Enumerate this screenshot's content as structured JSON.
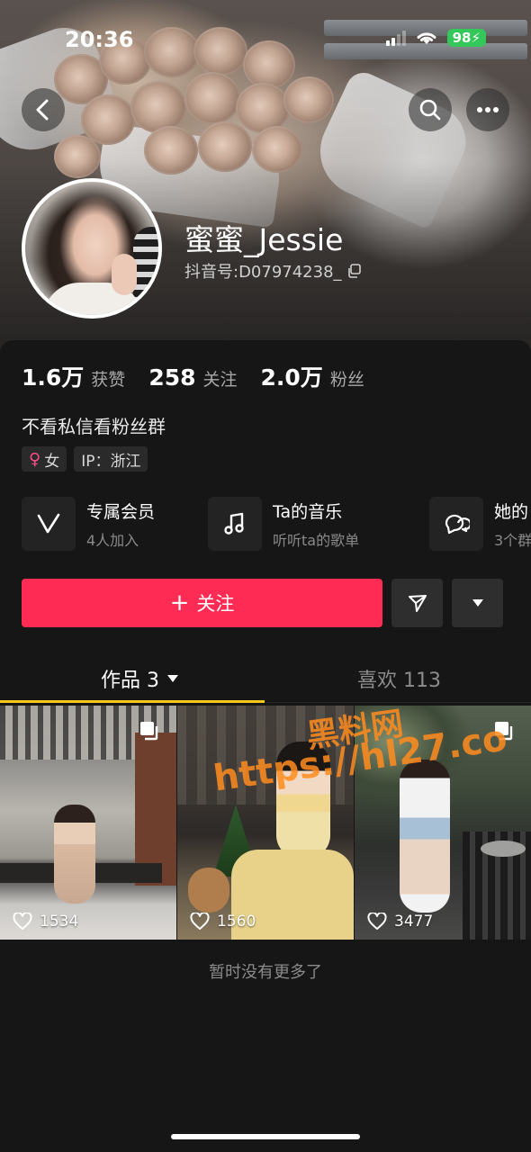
{
  "status_bar": {
    "time": "20:36",
    "battery": "98"
  },
  "profile": {
    "name": "蜜蜜_Jessie",
    "douyin_id": "抖音号:D07974238_",
    "stats": [
      {
        "value": "1.6万",
        "label": "获赞"
      },
      {
        "value": "258",
        "label": "关注"
      },
      {
        "value": "2.0万",
        "label": "粉丝"
      }
    ],
    "bio": "不看私信看粉丝群",
    "tags": {
      "gender": "女",
      "ip": "IP：浙江"
    }
  },
  "features": [
    {
      "title": "专属会员",
      "subtitle": "4人加入",
      "icon": "vip-v-icon"
    },
    {
      "title": "Ta的音乐",
      "subtitle": "听听ta的歌单",
      "icon": "music-note-icon"
    },
    {
      "title": "她的",
      "subtitle": "3个群",
      "icon": "chat-bubbles-icon"
    }
  ],
  "actions": {
    "follow_label": "关注"
  },
  "tabs": {
    "works": "作品 3",
    "likes": "喜欢 113"
  },
  "videos": [
    {
      "likes": "1534"
    },
    {
      "likes": "1560"
    },
    {
      "likes": "3477"
    }
  ],
  "footer": {
    "no_more": "暂时没有更多了"
  },
  "watermark": {
    "line1": "黑料网",
    "line2": "https://hl27.co"
  }
}
